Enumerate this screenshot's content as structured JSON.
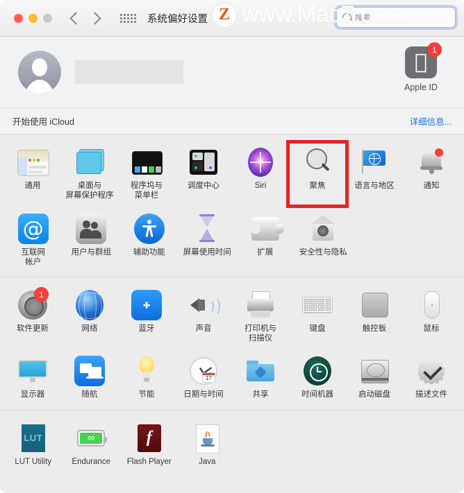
{
  "window": {
    "title": "系统偏好设置",
    "traffic_lights": [
      "close",
      "minimize",
      "zoom"
    ],
    "nav": {
      "back": "back-arrow",
      "forward": "forward-arrow"
    },
    "grid_button": "show-all-grid-icon"
  },
  "search": {
    "placeholder": "搜索",
    "icon": "search-icon",
    "focused": true
  },
  "watermark": {
    "logo_letter": "Z",
    "text": "www.MacZ.com"
  },
  "apple_id": {
    "avatar_icon": "user-avatar-icon",
    "user_name": "",
    "tile_label": "Apple ID",
    "badge_count": "1",
    "icon": "apple-logo-icon"
  },
  "icloud": {
    "text": "开始使用 iCloud",
    "link": "详细信息..."
  },
  "colors": {
    "accent_blue": "#1a74dd",
    "badge_red": "#fc3d39",
    "highlight_red": "#ec2024",
    "window_bg": "#ececec",
    "banner_bg": "#f1f2f4"
  },
  "highlight": {
    "target": "聚焦",
    "color": "#ec2024"
  },
  "sections": [
    {
      "id": "system-row-1",
      "panes": [
        {
          "label": "通用",
          "icon": "general-icon"
        },
        {
          "label": "桌面与\n屏幕保护程序",
          "icon": "desktop-screensaver-icon"
        },
        {
          "label": "程序坞与\n菜单栏",
          "icon": "dock-menubar-icon"
        },
        {
          "label": "调度中心",
          "icon": "mission-control-icon"
        },
        {
          "label": "Siri",
          "icon": "siri-icon"
        },
        {
          "label": "聚焦",
          "icon": "spotlight-icon",
          "highlighted": true
        },
        {
          "label": "语言与地区",
          "icon": "language-region-icon"
        },
        {
          "label": "通知",
          "icon": "notifications-icon",
          "badge_dot": true
        }
      ]
    },
    {
      "id": "system-row-2",
      "panes": [
        {
          "label": "互联网\n帐户",
          "icon": "internet-accounts-icon"
        },
        {
          "label": "用户与群组",
          "icon": "users-groups-icon"
        },
        {
          "label": "辅助功能",
          "icon": "accessibility-icon"
        },
        {
          "label": "屏幕使用时间",
          "icon": "screen-time-icon"
        },
        {
          "label": "扩展",
          "icon": "extensions-icon"
        },
        {
          "label": "安全性与隐私",
          "icon": "security-privacy-icon"
        }
      ]
    },
    {
      "id": "hardware-row-1",
      "panes": [
        {
          "label": "软件更新",
          "icon": "software-update-icon",
          "badge": "1"
        },
        {
          "label": "网络",
          "icon": "network-icon"
        },
        {
          "label": "蓝牙",
          "icon": "bluetooth-icon"
        },
        {
          "label": "声音",
          "icon": "sound-icon"
        },
        {
          "label": "打印机与\n扫描仪",
          "icon": "printers-scanners-icon"
        },
        {
          "label": "键盘",
          "icon": "keyboard-icon"
        },
        {
          "label": "触控板",
          "icon": "trackpad-icon"
        },
        {
          "label": "鼠标",
          "icon": "mouse-icon"
        }
      ]
    },
    {
      "id": "hardware-row-2",
      "panes": [
        {
          "label": "显示器",
          "icon": "displays-icon"
        },
        {
          "label": "随航",
          "icon": "sidecar-icon"
        },
        {
          "label": "节能",
          "icon": "energy-saver-icon"
        },
        {
          "label": "日期与时间",
          "icon": "date-time-icon"
        },
        {
          "label": "共享",
          "icon": "sharing-icon"
        },
        {
          "label": "时间机器",
          "icon": "time-machine-icon"
        },
        {
          "label": "启动磁盘",
          "icon": "startup-disk-icon"
        },
        {
          "label": "描述文件",
          "icon": "profiles-icon"
        }
      ]
    },
    {
      "id": "third-party-row",
      "panes": [
        {
          "label": "LUT Utility",
          "icon": "lut-utility-icon",
          "icon_text": "LUT"
        },
        {
          "label": "Endurance",
          "icon": "endurance-icon",
          "icon_text": "∞"
        },
        {
          "label": "Flash Player",
          "icon": "flash-player-icon",
          "icon_text": "f"
        },
        {
          "label": "Java",
          "icon": "java-icon"
        }
      ]
    }
  ]
}
